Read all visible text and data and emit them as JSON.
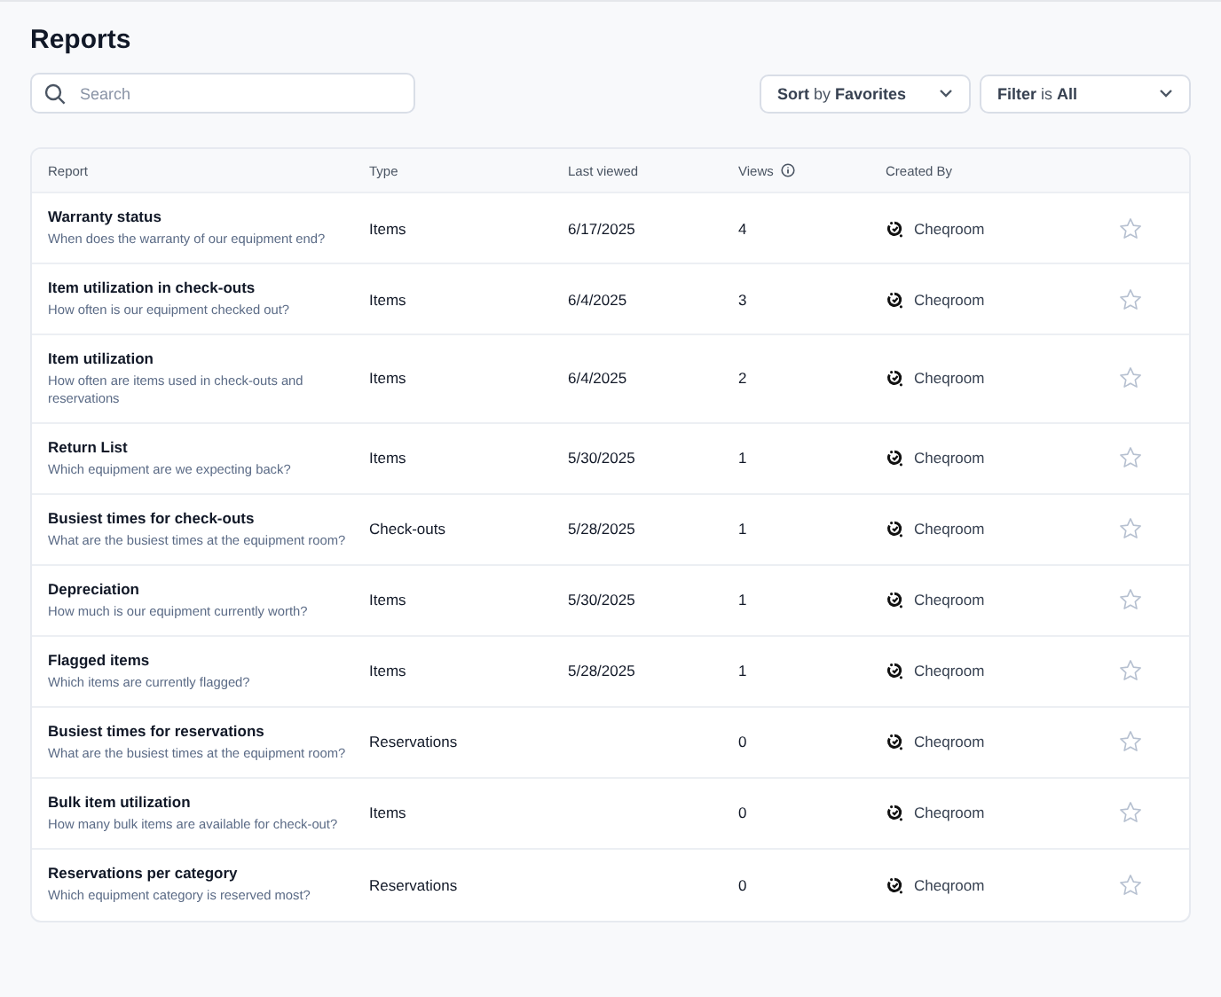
{
  "page": {
    "title": "Reports"
  },
  "search": {
    "placeholder": "Search"
  },
  "sort": {
    "label": "**Sort** by **Favorites**"
  },
  "filter": {
    "label": "**Filter** is **All**"
  },
  "table": {
    "columns": [
      "Report",
      "Type",
      "Last viewed",
      "Views",
      "Created By"
    ],
    "rows": [
      {
        "name": "Warranty status",
        "description": "When does the warranty of our equipment end?",
        "type": "Items",
        "last_viewed": "6/17/2025",
        "views": "4",
        "created_by": "Cheqroom",
        "favorite": false
      },
      {
        "name": "Item utilization in check-outs",
        "description": "How often is our equipment checked out?",
        "type": "Items",
        "last_viewed": "6/4/2025",
        "views": "3",
        "created_by": "Cheqroom",
        "favorite": false
      },
      {
        "name": "Item utilization",
        "description": "How often are items used in check-outs and reservations",
        "type": "Items",
        "last_viewed": "6/4/2025",
        "views": "2",
        "created_by": "Cheqroom",
        "favorite": false
      },
      {
        "name": "Return List",
        "description": "Which equipment are we expecting back?",
        "type": "Items",
        "last_viewed": "5/30/2025",
        "views": "1",
        "created_by": "Cheqroom",
        "favorite": false
      },
      {
        "name": "Busiest times for check-outs",
        "description": "What are the busiest times at the equipment room?",
        "type": "Check-outs",
        "last_viewed": "5/28/2025",
        "views": "1",
        "created_by": "Cheqroom",
        "favorite": false
      },
      {
        "name": "Depreciation",
        "description": "How much is our equipment currently worth?",
        "type": "Items",
        "last_viewed": "5/30/2025",
        "views": "1",
        "created_by": "Cheqroom",
        "favorite": false
      },
      {
        "name": "Flagged items",
        "description": "Which items are currently flagged?",
        "type": "Items",
        "last_viewed": "5/28/2025",
        "views": "1",
        "created_by": "Cheqroom",
        "favorite": false
      },
      {
        "name": "Busiest times for reservations",
        "description": "What are the busiest times at the equipment room?",
        "type": "Reservations",
        "views": "0",
        "created_by": "Cheqroom",
        "favorite": false
      },
      {
        "name": "Bulk item utilization",
        "description": "How many bulk items are available for check-out?",
        "type": "Items",
        "views": "0",
        "created_by": "Cheqroom",
        "favorite": false
      },
      {
        "name": "Reservations per category",
        "description": "Which equipment category is reserved most?",
        "type": "Reservations",
        "views": "0",
        "created_by": "Cheqroom",
        "favorite": false
      }
    ]
  }
}
